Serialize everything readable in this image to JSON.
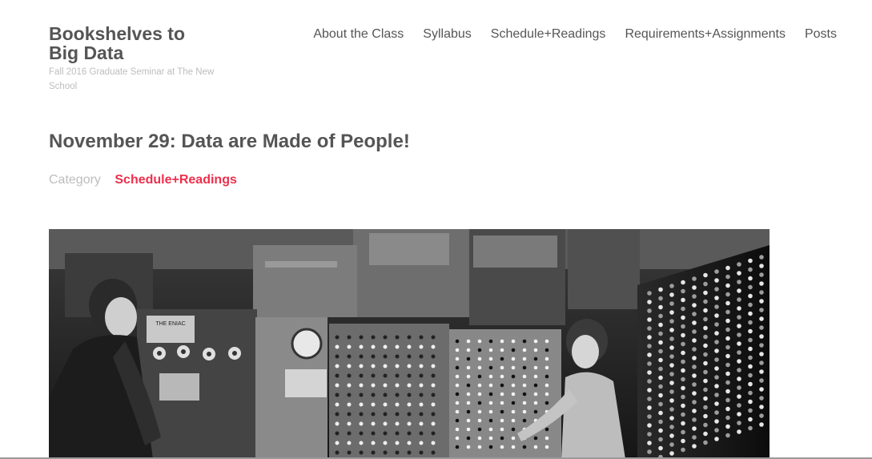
{
  "site": {
    "title": "Bookshelves to Big Data",
    "description": "Fall 2016 Graduate Seminar at The New School"
  },
  "nav": {
    "items": [
      {
        "label": "About the Class"
      },
      {
        "label": "Syllabus"
      },
      {
        "label": "Schedule+Readings"
      },
      {
        "label": "Requirements+Assignments"
      },
      {
        "label": "Posts"
      }
    ]
  },
  "post": {
    "title": "November 29: Data are Made of People!",
    "category_label": "Category",
    "category": "Schedule+Readings",
    "accent_color": "#ee2f4c",
    "image": {
      "subject": "black-and-white photo of two women operating a room-sized computer with panels of dials and plugboards",
      "panel_sign_lines": [
        "THE ENIAC"
      ]
    }
  }
}
